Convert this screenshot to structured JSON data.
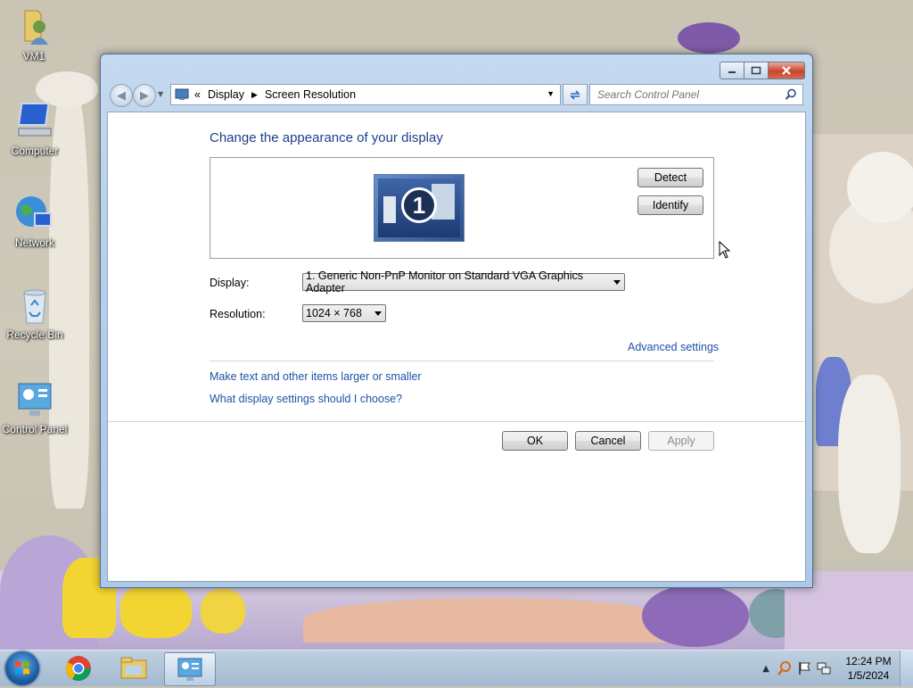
{
  "desktop": {
    "icons": [
      {
        "label": "VM1",
        "icon": "user-folder-icon"
      },
      {
        "label": "Computer",
        "icon": "computer-icon"
      },
      {
        "label": "Network",
        "icon": "network-icon"
      },
      {
        "label": "Recycle Bin",
        "icon": "recycle-bin-icon"
      },
      {
        "label": "Control Panel",
        "icon": "control-panel-icon"
      }
    ]
  },
  "window": {
    "breadcrumb": {
      "root_glyph": "«",
      "item1": "Display",
      "item2": "Screen Resolution"
    },
    "search_placeholder": "Search Control Panel",
    "heading": "Change the appearance of your display",
    "monitor_number": "1",
    "detect_label": "Detect",
    "identify_label": "Identify",
    "display_label": "Display:",
    "display_value": "1. Generic Non-PnP Monitor on Standard VGA Graphics Adapter",
    "resolution_label": "Resolution:",
    "resolution_value": "1024 × 768",
    "advanced_link": "Advanced settings",
    "link_text_size": "Make text and other items larger or smaller",
    "link_settings_help": "What display settings should I choose?",
    "ok_label": "OK",
    "cancel_label": "Cancel",
    "apply_label": "Apply"
  },
  "taskbar": {
    "items": [
      "start-orb",
      "chrome-icon",
      "explorer-icon",
      "control-panel-icon"
    ],
    "time": "12:24 PM",
    "date": "1/5/2024"
  }
}
